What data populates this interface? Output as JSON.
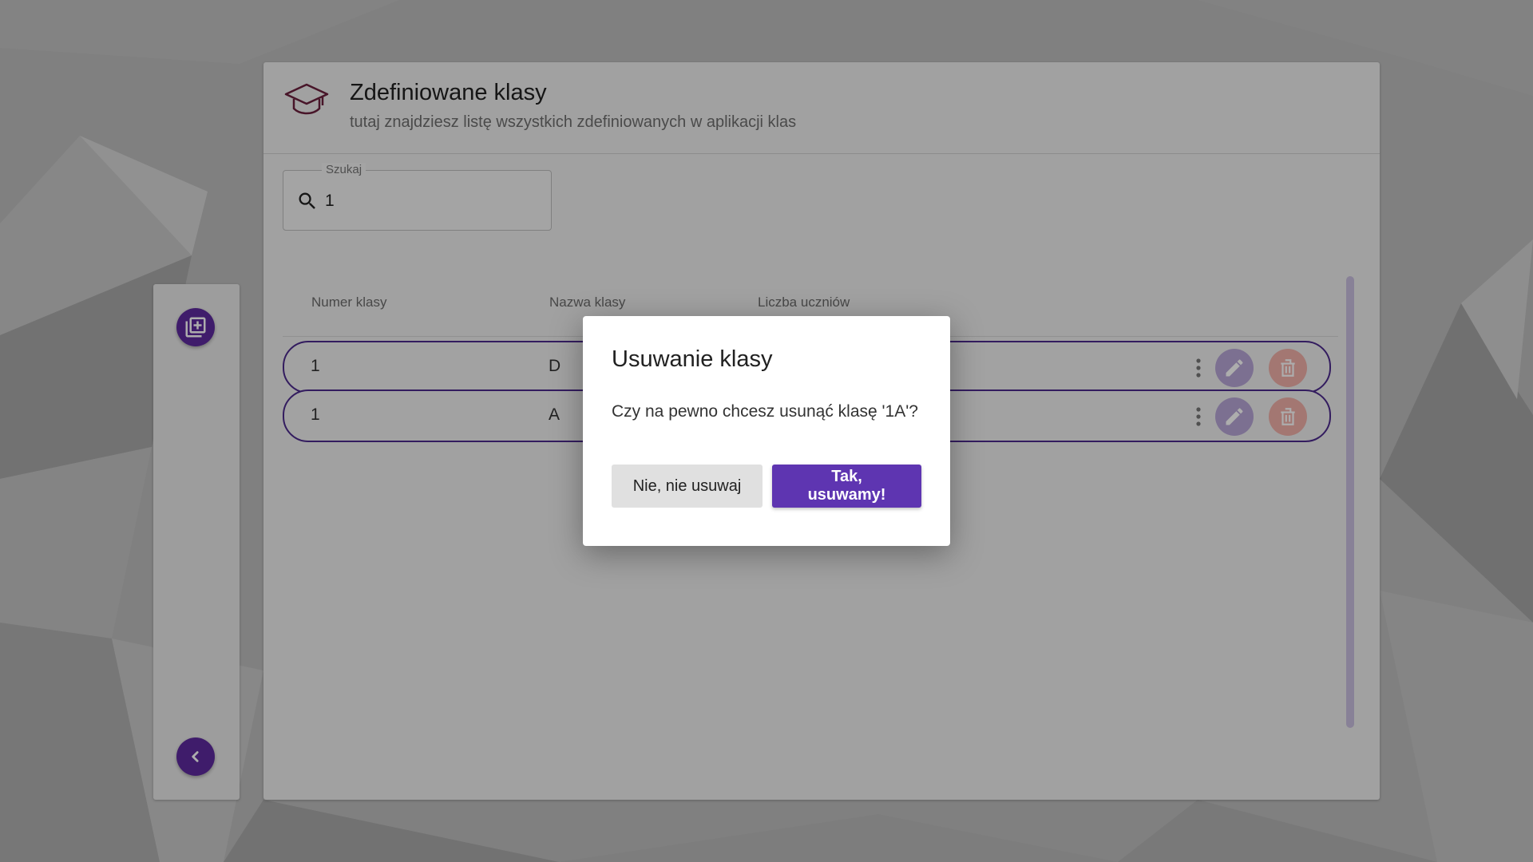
{
  "header": {
    "title": "Zdefiniowane klasy",
    "subtitle": "tutaj znajdziesz listę wszystkich zdefiniowanych w aplikacji klas",
    "icon": "graduation-cap-icon"
  },
  "search": {
    "label": "Szukaj",
    "value": "1"
  },
  "table": {
    "columns": [
      "Numer klasy",
      "Nazwa klasy",
      "Liczba uczniów"
    ],
    "rows": [
      {
        "number": "1",
        "name": "D"
      },
      {
        "number": "1",
        "name": "A"
      }
    ]
  },
  "sidebar": {
    "add_icon": "add-library-icon",
    "back_icon": "chevron-left-icon"
  },
  "dialog": {
    "title": "Usuwanie klasy",
    "message": "Czy na pewno chcesz usunąć klasę '1A'?",
    "cancel_label": "Nie, nie usuwaj",
    "confirm_label": "Tak, usuwamy!"
  },
  "colors": {
    "accent": "#5e35b1",
    "row_border": "#4c2a8c",
    "delete": "#f0b0a8"
  }
}
